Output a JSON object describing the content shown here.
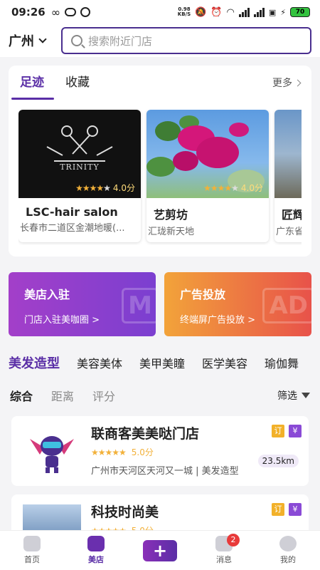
{
  "status_bar": {
    "time": "09:26",
    "network_speed_top": "0.98",
    "network_speed_unit": "KB/S",
    "net1": "4G",
    "net2": "4G",
    "battery": "70"
  },
  "header": {
    "city": "广州",
    "search_placeholder": "搜索附近门店"
  },
  "footprint": {
    "tabs": [
      {
        "label": "足迹",
        "active": true
      },
      {
        "label": "收藏",
        "active": false
      }
    ],
    "more_label": "更多",
    "shops": [
      {
        "name": "LSC-hair salon",
        "address": "长春市二道区金潮地暖(...",
        "rating": "4.0分",
        "logo_text": "TRINITY"
      },
      {
        "name": "艺剪坊",
        "address": "汇珑新天地",
        "rating": "4.0分"
      },
      {
        "name": "匠辉",
        "address": "广东省"
      }
    ]
  },
  "promos": [
    {
      "title": "美店入驻",
      "subtitle": "门店入驻美咖圈 >",
      "deco": "M"
    },
    {
      "title": "广告投放",
      "subtitle": "终端屏广告投放 >",
      "deco": "AD"
    }
  ],
  "categories": [
    "美发造型",
    "美容美体",
    "美甲美瞳",
    "医学美容",
    "瑜伽舞"
  ],
  "sort": {
    "items": [
      "综合",
      "距离",
      "评分"
    ],
    "filter_label": "筛选"
  },
  "stores": [
    {
      "name": "联商客美美哒门店",
      "score": "5.0分",
      "address": "广州市天河区天河又一城 | 美发造型",
      "distance": "23.5km",
      "badges": [
        "订",
        "¥"
      ]
    },
    {
      "name": "科技时尚美",
      "score": "5.0分",
      "badges": [
        "订",
        "¥"
      ]
    }
  ],
  "tabbar": [
    {
      "label": "首页",
      "icon": "home-icon"
    },
    {
      "label": "美店",
      "icon": "store-icon",
      "active": true
    },
    {
      "label": "+",
      "icon": "plus-icon"
    },
    {
      "label": "消息",
      "icon": "bell-icon",
      "badge": "2"
    },
    {
      "label": "我的",
      "icon": "profile-icon"
    }
  ],
  "colors": {
    "accent": "#5a2ea6",
    "star": "#f2b13a",
    "badge_ding": "#f2b12a",
    "badge_yen": "#8a4ad6"
  }
}
